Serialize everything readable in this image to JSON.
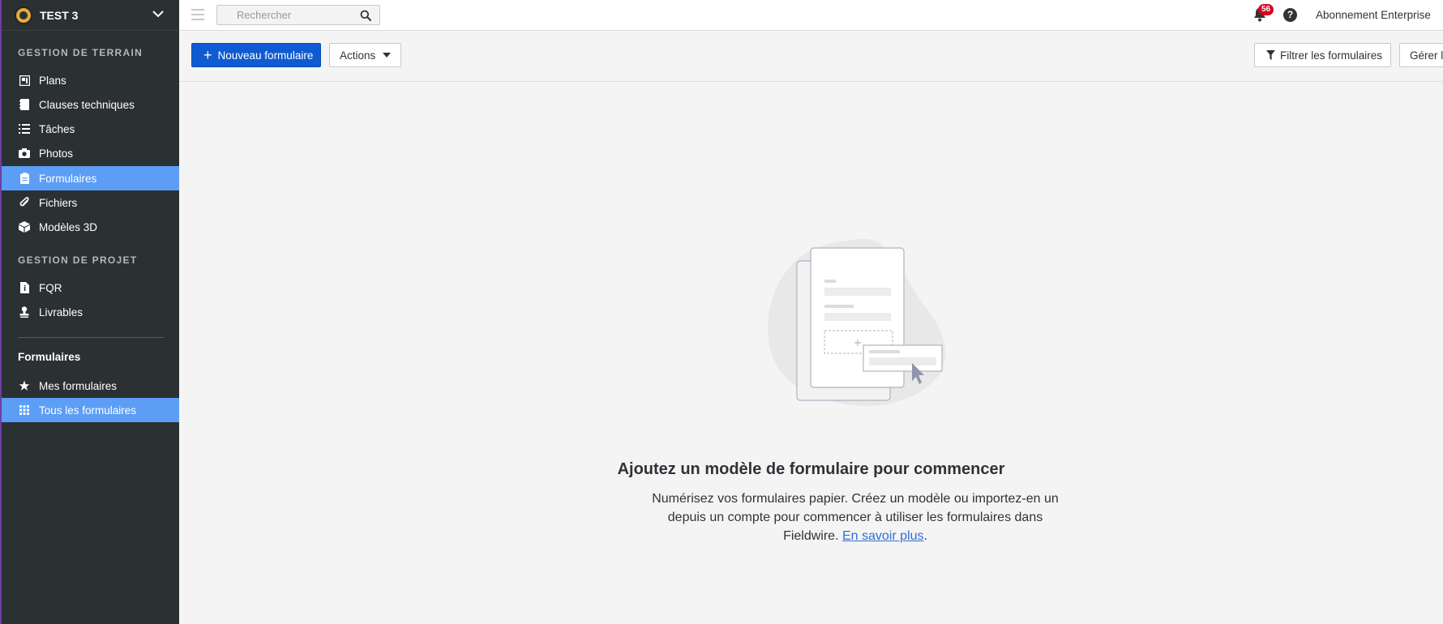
{
  "project": {
    "name": "TEST 3"
  },
  "sidebar": {
    "field_title": "GESTION DE TERRAIN",
    "field_items": [
      {
        "label": "Plans",
        "icon": "plans-icon"
      },
      {
        "label": "Clauses techniques",
        "icon": "book-icon"
      },
      {
        "label": "Tâches",
        "icon": "list-icon"
      },
      {
        "label": "Photos",
        "icon": "camera-icon"
      },
      {
        "label": "Formulaires",
        "icon": "clipboard-icon",
        "active": true
      },
      {
        "label": "Fichiers",
        "icon": "paperclip-icon"
      },
      {
        "label": "Modèles 3D",
        "icon": "cube-icon"
      }
    ],
    "project_title": "GESTION DE PROJET",
    "project_items": [
      {
        "label": "FQR",
        "icon": "document-info-icon"
      },
      {
        "label": "Livrables",
        "icon": "stamp-icon"
      }
    ],
    "forms_title": "Formulaires",
    "forms_items": [
      {
        "label": "Mes formulaires",
        "icon": "star-icon"
      },
      {
        "label": "Tous les formulaires",
        "icon": "grid-icon",
        "active": true
      }
    ]
  },
  "topbar": {
    "search_placeholder": "Rechercher",
    "notifications_count": "56",
    "help_label": "?",
    "subscription": "Abonnement Enterprise"
  },
  "toolbar": {
    "new_form": "Nouveau formulaire",
    "actions": "Actions",
    "filter": "Filtrer les formulaires",
    "manage": "Gérer l"
  },
  "empty_state": {
    "title": "Ajoutez un modèle de formulaire pour commencer",
    "description": "Numérisez vos formulaires papier. Créez un modèle ou importez-en un depuis un compte pour commencer à utiliser les formulaires dans Fieldwire.",
    "link": "En savoir plus",
    "suffix": "."
  },
  "colors": {
    "sidebar_bg": "#2b3033",
    "active_item": "#5c9ef5",
    "primary_button": "#0f5bd1",
    "badge": "#d9001b"
  }
}
